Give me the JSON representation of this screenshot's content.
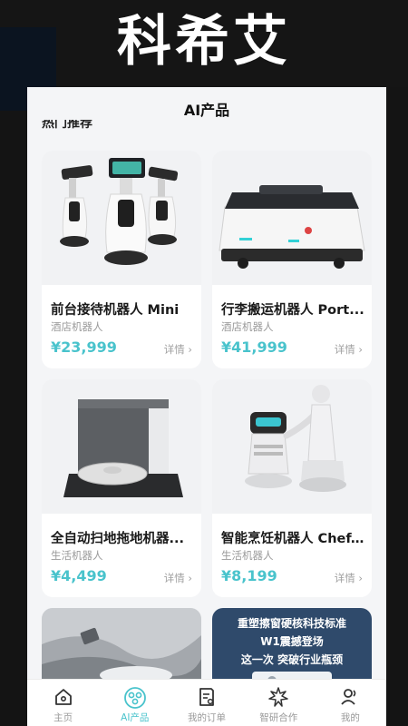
{
  "banner": {
    "title": "科希艾"
  },
  "header": {
    "title": "AI产品"
  },
  "section": {
    "heading": "热门推荐"
  },
  "products": [
    {
      "name": "前台接待机器人 Mini",
      "category": "酒店机器人",
      "price": "¥23,999",
      "detail": "详情 ›"
    },
    {
      "name": "行李搬运机器人 Port...",
      "category": "酒店机器人",
      "price": "¥41,999",
      "detail": "详情 ›"
    },
    {
      "name": "全自动扫地拖地机器...",
      "category": "生活机器人",
      "price": "¥4,499",
      "detail": "详情 ›"
    },
    {
      "name": "智能烹饪机器人 Chef...",
      "category": "生活机器人",
      "price": "¥8,199",
      "detail": "详情 ›"
    }
  ],
  "promo": {
    "line1": "重塑擦窗硬核科技标准",
    "line2": "W1震撼登场",
    "line3": "这一次 突破行业瓶颈"
  },
  "tabbar": [
    {
      "label": "主页",
      "icon": "home-icon",
      "active": false
    },
    {
      "label": "AI产品",
      "icon": "ai-product-icon",
      "active": true
    },
    {
      "label": "我的订单",
      "icon": "order-icon",
      "active": false
    },
    {
      "label": "智研合作",
      "icon": "cooperation-icon",
      "active": false
    },
    {
      "label": "我的",
      "icon": "profile-icon",
      "active": false
    }
  ],
  "colors": {
    "accent": "#49c3cc",
    "price": "#49c3cc",
    "inactive": "#9a9a9a"
  }
}
